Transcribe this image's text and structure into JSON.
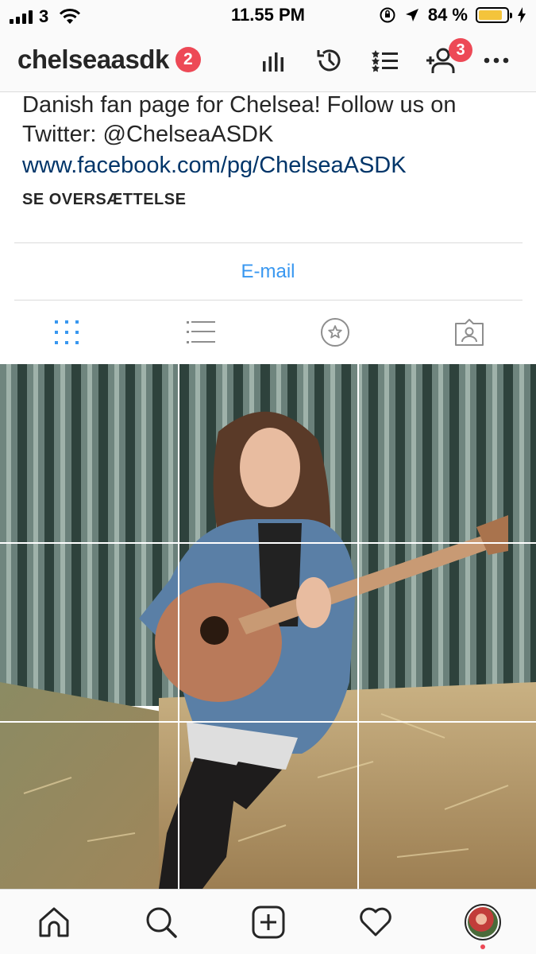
{
  "status_bar": {
    "carrier": "3",
    "time": "11.55 PM",
    "battery_percent": "84 %",
    "battery_level": 0.84
  },
  "nav": {
    "username": "chelseaasdk",
    "account_badge": "2",
    "follow_requests_badge": "3",
    "icons": [
      "insights-icon",
      "archive-icon",
      "list-icon",
      "add-person-icon",
      "more-icon"
    ]
  },
  "bio": {
    "text": "Danish fan page for Chelsea! Follow us on Twitter: @ChelseaASDK",
    "link": "www.facebook.com/pg/ChelseaASDK",
    "translate": "SE OVERSÆTTELSE"
  },
  "contact": {
    "email_label": "E-mail"
  },
  "tabs": [
    "grid-icon",
    "list-view-icon",
    "saved-icon",
    "tagged-icon"
  ],
  "colors": {
    "accent": "#3897f0",
    "badge": "#ed4956",
    "link": "#003569",
    "battery": "#f4c43b"
  },
  "bottom_bar": [
    "home-icon",
    "search-icon",
    "new-post-icon",
    "activity-icon",
    "profile-avatar"
  ]
}
